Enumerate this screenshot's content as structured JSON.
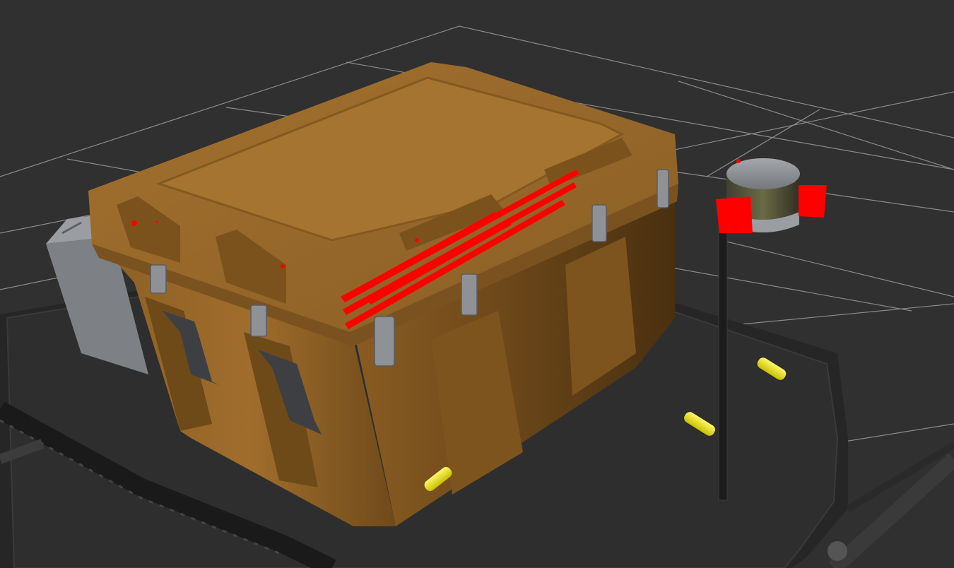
{
  "scene": {
    "background_color": "#303030",
    "grid_color": "#a0a0a0",
    "platform_color": "#2b2b2b",
    "case_color": "#9a6a2c",
    "case_shadow_color": "#6f4a1c",
    "grey_box_color": "#7d8084",
    "lidar_top_color": "#8d9094",
    "lidar_window_color": "#5a5a3a",
    "lidar_pole_color": "#1c1c1c",
    "point_cloud_color": "#ff0000",
    "marker_color": "#e8e000",
    "objects": [
      {
        "name": "transport-case",
        "icon": "crate-icon"
      },
      {
        "name": "grey-box",
        "icon": "box-icon"
      },
      {
        "name": "lidar-sensor",
        "icon": "lidar-icon"
      },
      {
        "name": "mobile-platform",
        "icon": "platform-icon"
      }
    ]
  }
}
